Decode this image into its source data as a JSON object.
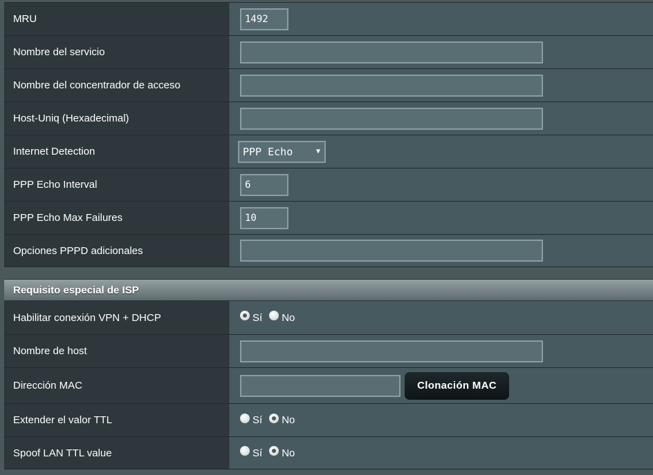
{
  "pppoe": [
    {
      "label": "MRU",
      "type": "input",
      "size": "short",
      "value": "1492"
    },
    {
      "label": "Nombre del servicio",
      "type": "input",
      "size": "long",
      "value": ""
    },
    {
      "label": "Nombre del concentrador de acceso",
      "type": "input",
      "size": "long",
      "value": ""
    },
    {
      "label": "Host-Uniq (Hexadecimal)",
      "type": "input",
      "size": "long",
      "value": ""
    },
    {
      "label": "Internet Detection",
      "type": "select",
      "value": "PPP Echo"
    },
    {
      "label": "PPP Echo Interval",
      "type": "input",
      "size": "short",
      "value": "6"
    },
    {
      "label": "PPP Echo Max Failures",
      "type": "input",
      "size": "short",
      "value": "10"
    },
    {
      "label": "Opciones PPPD adicionales",
      "type": "input",
      "size": "long",
      "value": ""
    }
  ],
  "isp": {
    "title": "Requisito especial de ISP",
    "yes": "Sí",
    "no": "No",
    "vpn_dhcp": {
      "label": "Habilitar conexión VPN + DHCP",
      "selected": "yes"
    },
    "hostname": {
      "label": "Nombre de host",
      "value": ""
    },
    "mac": {
      "label": "Dirección MAC",
      "value": "",
      "button": "Clonación MAC"
    },
    "ttl": {
      "label": "Extender el valor TTL",
      "selected": "no"
    },
    "spoof": {
      "label": "Spoof LAN TTL value",
      "selected": "no"
    }
  }
}
